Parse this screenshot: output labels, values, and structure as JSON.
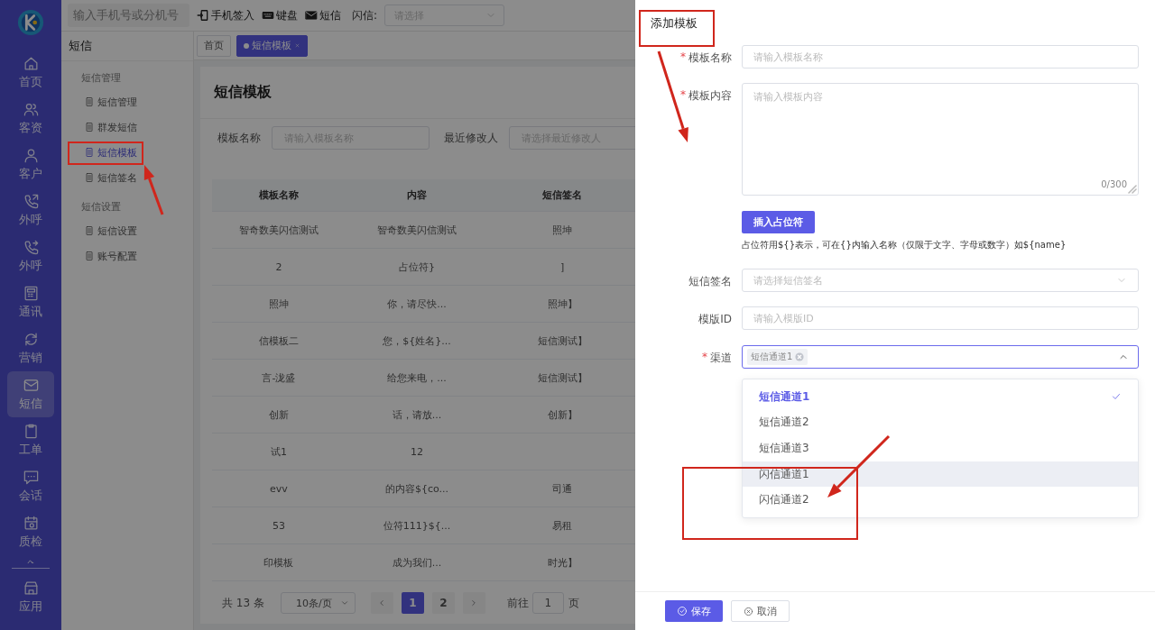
{
  "nav_rail": {
    "items": [
      {
        "label": "首页",
        "selected": false
      },
      {
        "label": "客资",
        "selected": false
      },
      {
        "label": "客户",
        "selected": false
      },
      {
        "label": "外呼",
        "selected": false
      },
      {
        "label": "外呼",
        "selected": false
      },
      {
        "label": "通讯",
        "selected": false
      },
      {
        "label": "营销",
        "selected": false
      },
      {
        "label": "短信",
        "selected": true
      },
      {
        "label": "工单",
        "selected": false
      },
      {
        "label": "会话",
        "selected": false
      },
      {
        "label": "质检",
        "selected": false
      }
    ],
    "footer_items": [
      {
        "label": "应用",
        "selected": false
      }
    ]
  },
  "top_bar": {
    "search": {
      "placeholder": "输入手机号或分机号"
    },
    "actions": [
      "手机签入",
      "键盘",
      "短信"
    ],
    "flash_label": "闪信:",
    "flash_select": {
      "placeholder": "请选择"
    }
  },
  "side_menu": {
    "title": "短信",
    "groups": [
      {
        "title": "短信管理",
        "items": [
          {
            "label": "短信管理",
            "selected": false
          },
          {
            "label": "群发短信",
            "selected": false
          },
          {
            "label": "短信模板",
            "selected": true
          },
          {
            "label": "短信签名",
            "selected": false
          }
        ]
      },
      {
        "title": "短信设置",
        "items": [
          {
            "label": "短信设置",
            "selected": false
          },
          {
            "label": "账号配置",
            "selected": false
          }
        ]
      }
    ]
  },
  "tabs": [
    {
      "label": "首页",
      "selected": false
    },
    {
      "label": "短信模板",
      "selected": true
    }
  ],
  "page": {
    "title": "短信模板",
    "filters": [
      {
        "label": "模板名称",
        "placeholder": "请输入模板名称"
      },
      {
        "label": "最近修改人",
        "placeholder": "请选择最近修改人"
      }
    ],
    "table": {
      "columns": [
        "模板名称",
        "内容",
        "短信签名"
      ],
      "rows": [
        [
          "智奇数美闪信测试",
          "智奇数美闪信测试",
          "照坤"
        ],
        [
          "2",
          "占位符}",
          "]"
        ],
        [
          "照坤",
          "你，请尽快...",
          "照坤】"
        ],
        [
          "信模板二",
          "您，${姓名}...",
          "短信测试】"
        ],
        [
          "言-泷盛",
          "给您来电，...",
          "短信测试】"
        ],
        [
          "创新",
          "话，请放...",
          "创新】"
        ],
        [
          "试1",
          "12",
          null
        ],
        [
          "evv",
          "的内容${co...",
          "司通"
        ],
        [
          "53",
          "位符111}${...",
          "易租"
        ],
        [
          "印模板",
          "成为我们...",
          "时光】"
        ]
      ]
    },
    "pagination": {
      "total": "共 13 条",
      "page_size": "10条/页",
      "pages": [
        {
          "label": "1",
          "selected": true
        },
        {
          "label": "2",
          "selected": false
        }
      ],
      "goto_label": "前往",
      "goto_value": "1",
      "goto_suffix": "页"
    }
  },
  "drawer": {
    "title": "添加模板",
    "fields": [
      {
        "kind": "input",
        "label": "模板名称",
        "required_mark": "*",
        "placeholder": "请输入模板名称"
      },
      {
        "kind": "textarea",
        "label": "模板内容",
        "required_mark": "*",
        "placeholder": "请输入模板内容",
        "counter": "0/300"
      },
      {
        "kind": "button",
        "button": "插入占位符",
        "hint": "占位符用${}表示，可在{}内输入名称（仅限于文字、字母或数字）如${name}"
      },
      {
        "kind": "select",
        "label": "短信签名",
        "placeholder": "请选择短信签名"
      },
      {
        "kind": "input",
        "label": "模版ID",
        "placeholder": "请输入模版ID"
      },
      {
        "kind": "multiselect",
        "label": "渠道",
        "required_mark": "*",
        "tags": [
          "短信通道1"
        ],
        "expanded": true,
        "options": [
          {
            "label": "短信通道1",
            "selected": true,
            "highlighted": false
          },
          {
            "label": "短信通道2",
            "selected": false,
            "highlighted": false
          },
          {
            "label": "短信通道3",
            "selected": false,
            "highlighted": false
          },
          {
            "label": "闪信通道1",
            "selected": false,
            "highlighted": true
          },
          {
            "label": "闪信通道2",
            "selected": false,
            "highlighted": false
          }
        ]
      }
    ],
    "buttons": [
      {
        "label": "保存",
        "kind": "primary"
      },
      {
        "label": "取消",
        "kind": "default"
      }
    ]
  }
}
